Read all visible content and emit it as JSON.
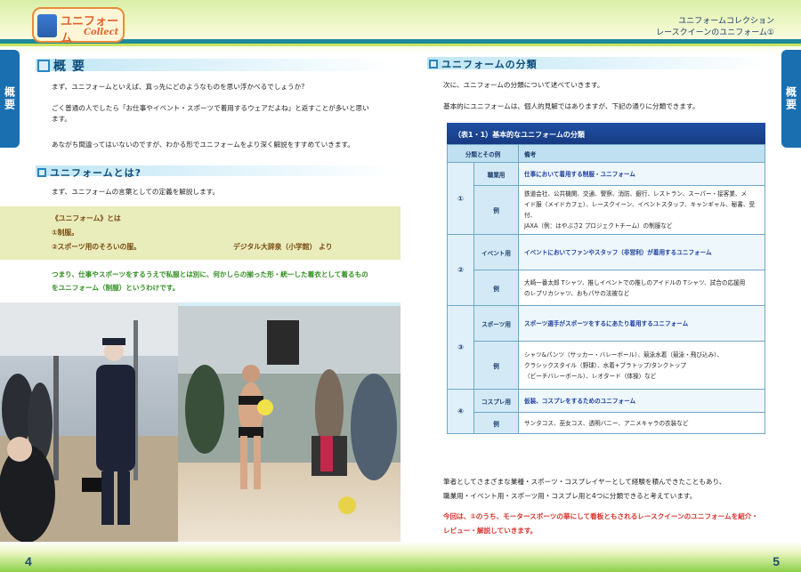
{
  "left_page": {
    "logo": {
      "title": "ユニフォーム",
      "subtitle": "Collect"
    },
    "side_tab": "概要",
    "heading": "概 要",
    "intro": [
      "まず、ユニフォームといえば、真っ先にどのようなものを思い浮かべるでしょうか?",
      "ごく普通の人でしたら「お仕事やイベント・スポーツで着用するウェアだよね」と返すことが多いと思い",
      "ます。",
      "あながち間違ってはいないのですが、わかる形でユニフォームをより深く解説をすすめていきます。"
    ],
    "subheading": "ユニフォームとは?",
    "sub_intro": "まず、ユニフォームの言葉としての定義を解説します。",
    "definition": {
      "label": "《ユニフォーム》とは",
      "item1": "①制服。",
      "item2": "②スポーツ用のそろいの服。",
      "source": "デジタル大辞泉（小学館） より"
    },
    "conclusion": [
      "つまり、仕事やスポーツをするうえで私服とは別に、何かしらの揃った形・統一した着衣として着るもの",
      "をユニフォーム（制服）というわけです。"
    ],
    "page_number": "4"
  },
  "right_page": {
    "header": {
      "line1": "ユニフォームコレクション",
      "line2": "レースクイーンのユニフォーム①"
    },
    "side_tab": "概要",
    "heading": "ユニフォームの分類",
    "intro1": "次に、ユニフォームの分類について述べていきます。",
    "intro2": "基本的にユニフォームは、個人的見解ではありますが、下記の通りに分類できます。",
    "table": {
      "caption": "（表1・1）基本的なユニフォームの分類",
      "header_category": "分類とその例",
      "header_note": "備考",
      "rows": [
        {
          "num": "①",
          "category": "職業用",
          "definition": "仕事において着用する制服・ユニフォーム",
          "example_label": "例",
          "examples": [
            "鉄道会社、公共機関、交通、警察、消防、銀行、レストラン、スーパー・接客業、メ",
            "イド服（メイドカフェ）、レースクイーン、イベントスタッフ、キャンギャル、秘書、受付、",
            "JAXA（例：はやぶさ2 プロジェクトチーム）の制服など"
          ]
        },
        {
          "num": "②",
          "category": "イベント用",
          "definition": "イベントにおいてファンやスタッフ（非営利）が着用するユニフォーム",
          "example_label": "例",
          "examples": [
            "大崎一番太郎 Tシャツ、推しイベントでの推しのアイドルの Tシャツ、試合の応援用",
            "のレプリカシャツ、おもパサの法被など"
          ]
        },
        {
          "num": "③",
          "category": "スポーツ用",
          "definition": "スポーツ選手がスポーツをするにあたり着用するユニフォーム",
          "example_label": "例",
          "examples": [
            "シャツ&パンツ（サッカー・バレーボール）、競泳水着（競泳・飛び込み）、",
            "クラシックスタイル（野球）、水着+ブラトップ/タンクトップ",
            "（ビーチバレーボール）、レオタード（体操）など"
          ]
        },
        {
          "num": "④",
          "category": "コスプレ用",
          "definition": "仮装、コスプレをするためのユニフォーム",
          "example_label": "例",
          "examples": [
            "サンタコス、巫女コス、透明バニー、アニメキャラの衣装など"
          ]
        }
      ]
    },
    "outro": [
      "筆者としてさまざまな業種・スポーツ・コスプレイヤーとして経験を積んできたこともあり、",
      "職業用・イベント用・スポーツ用・コスプレ用と4つに分類できると考えています。"
    ],
    "closing": [
      "今回は、①のうち、モータースポーツの華にして看板ともされるレースクイーンのユニフォームを紹介・",
      "レビュー・解説していきます。"
    ],
    "page_number": "5"
  },
  "colors": {
    "accent": "#1a6fb0",
    "heading": "#0e4d7a",
    "green_text": "#2f8f1e",
    "red_text": "#d8322a",
    "table_header": "#1f4fa3"
  }
}
